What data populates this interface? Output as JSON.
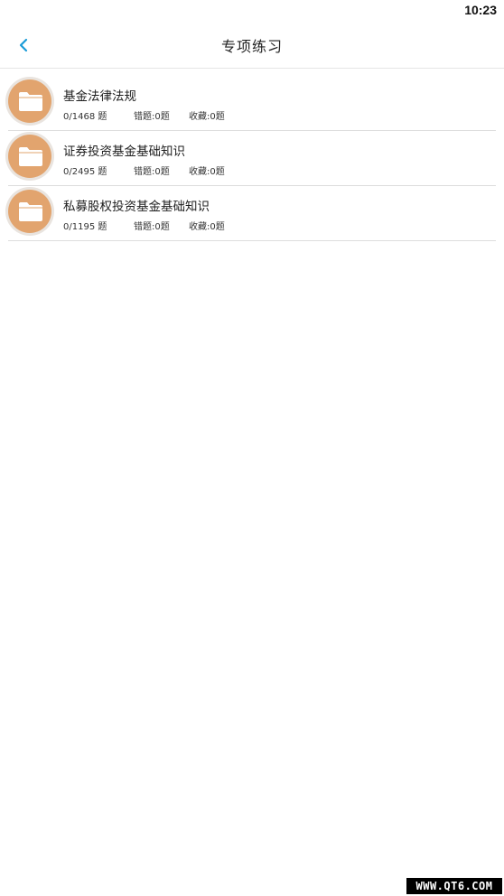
{
  "status_bar": {
    "time": "10:23"
  },
  "header": {
    "title": "专项练习"
  },
  "items": [
    {
      "title": "基金法律法规",
      "progress": "0/1468 题",
      "wrong": "错题:0题",
      "favorites": "收藏:0题"
    },
    {
      "title": "证券投资基金基础知识",
      "progress": "0/2495 题",
      "wrong": "错题:0题",
      "favorites": "收藏:0题"
    },
    {
      "title": "私募股权投资基金基础知识",
      "progress": "0/1195 题",
      "wrong": "错题:0题",
      "favorites": "收藏:0题"
    }
  ],
  "watermark": "WWW.QT6.COM",
  "colors": {
    "accent": "#1a9bd7",
    "avatar_fill": "#e2a46e",
    "divider": "#dddddd"
  }
}
